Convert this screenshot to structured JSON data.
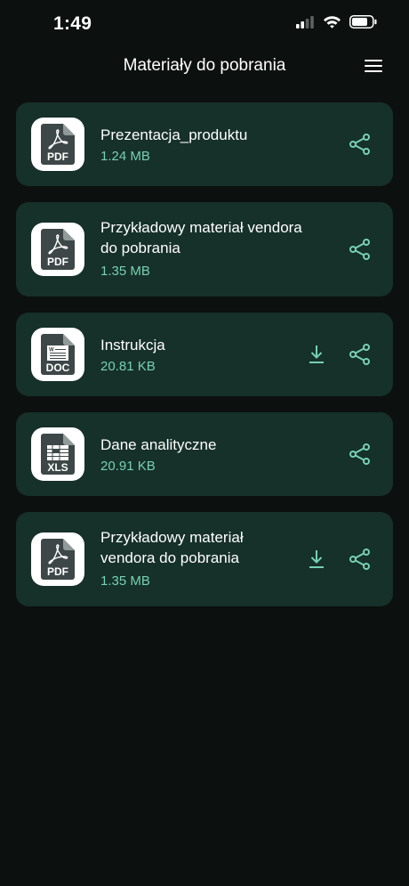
{
  "status_bar": {
    "time": "1:49"
  },
  "header": {
    "title": "Materiały do pobrania"
  },
  "colors": {
    "background": "#0c100f",
    "card": "#16302a",
    "accent": "#76d1b1",
    "icon_dark": "#3d4748"
  },
  "files": [
    {
      "name": "Prezentacja_produktu",
      "size": "1.24 MB",
      "type": "PDF",
      "icon": "pdf-file-icon",
      "download": false,
      "share": true
    },
    {
      "name": "Przykładowy materiał vendora do pobrania",
      "size": "1.35 MB",
      "type": "PDF",
      "icon": "pdf-file-icon",
      "download": false,
      "share": true
    },
    {
      "name": "Instrukcja",
      "size": "20.81 KB",
      "type": "DOC",
      "icon": "doc-file-icon",
      "download": true,
      "share": true
    },
    {
      "name": "Dane analityczne",
      "size": "20.91 KB",
      "type": "XLS",
      "icon": "xls-file-icon",
      "download": false,
      "share": true
    },
    {
      "name": "Przykładowy materiał vendora do pobrania",
      "size": "1.35 MB",
      "type": "PDF",
      "icon": "pdf-file-icon",
      "download": true,
      "share": true
    }
  ]
}
